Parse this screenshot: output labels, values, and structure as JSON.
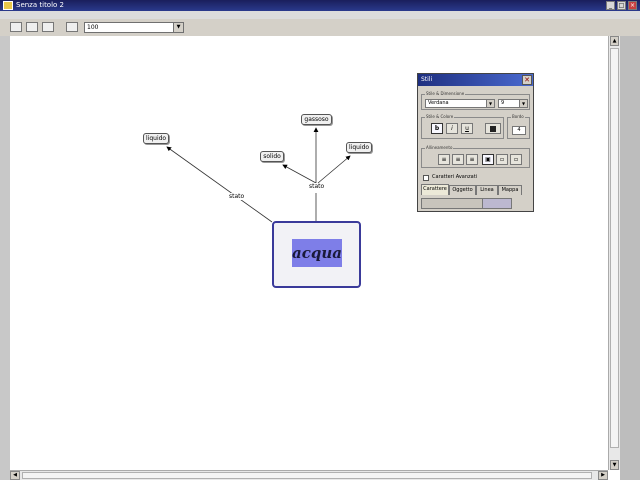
{
  "window": {
    "title": "Senza titolo 2",
    "minimize": "_",
    "maximize": "□",
    "close": "×"
  },
  "toolbar": {
    "zoom_value": "100"
  },
  "map": {
    "main_concept": "acqua",
    "concepts": [
      "liquido",
      "solido",
      "gassoso",
      "liquido"
    ],
    "link_words": [
      "stato",
      "stato"
    ]
  },
  "styles_panel": {
    "title": "Stili",
    "font_group_label": "Stile & Dimensione",
    "font_name": "Verdana",
    "font_size": "9",
    "text_style_label": "Stile & Colore",
    "bold": "b",
    "italic": "i",
    "underline": "u",
    "border_label": "Bordo",
    "border_value": "4",
    "align_label": "Allineamento",
    "advanced_label": "Caratteri Avanzati",
    "tabs": [
      "Carattere",
      "Oggetto",
      "Linea",
      "Mappa"
    ]
  },
  "colors": {
    "accent": "#3a3a9a",
    "highlight": "#7e7ee8"
  }
}
